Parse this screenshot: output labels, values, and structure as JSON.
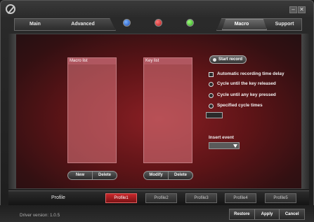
{
  "window": {
    "minimize_glyph": "–",
    "close_glyph": "✕"
  },
  "tabs": {
    "main": "Main",
    "advanced": "Advanced",
    "macro": "Macro",
    "support": "Support",
    "active": "Macro"
  },
  "indicators": {
    "colors": [
      "#1b4fb8",
      "#b81b1b",
      "#2d9d20"
    ]
  },
  "macro_list": {
    "header": "Macro list",
    "buttons": [
      "New",
      "Delete"
    ]
  },
  "key_list": {
    "header": "Key list",
    "buttons": [
      "Modify",
      "Delete"
    ]
  },
  "record": {
    "start_label": "Start record",
    "auto_delay_label": "Automatic recording time delay",
    "cycle_released_label": "Cycle until the key released",
    "cycle_any_label": "Cycle until any key pressed",
    "cycle_specified_label": "Specified cycle times",
    "cycle_times_value": ""
  },
  "insert_event": {
    "label": "Insert event",
    "value": ""
  },
  "profile": {
    "label": "Profile",
    "tabs": [
      "Profile1",
      "Profile2",
      "Profile3",
      "Profile4",
      "Profile5"
    ],
    "active": "Profile1"
  },
  "footer": {
    "driver_version": "Driver version: 1.0.5",
    "buttons": [
      "Restore",
      "Apply",
      "Cancel"
    ]
  },
  "colors": {
    "accent": "#c8272b",
    "panel": "#5e1417"
  }
}
